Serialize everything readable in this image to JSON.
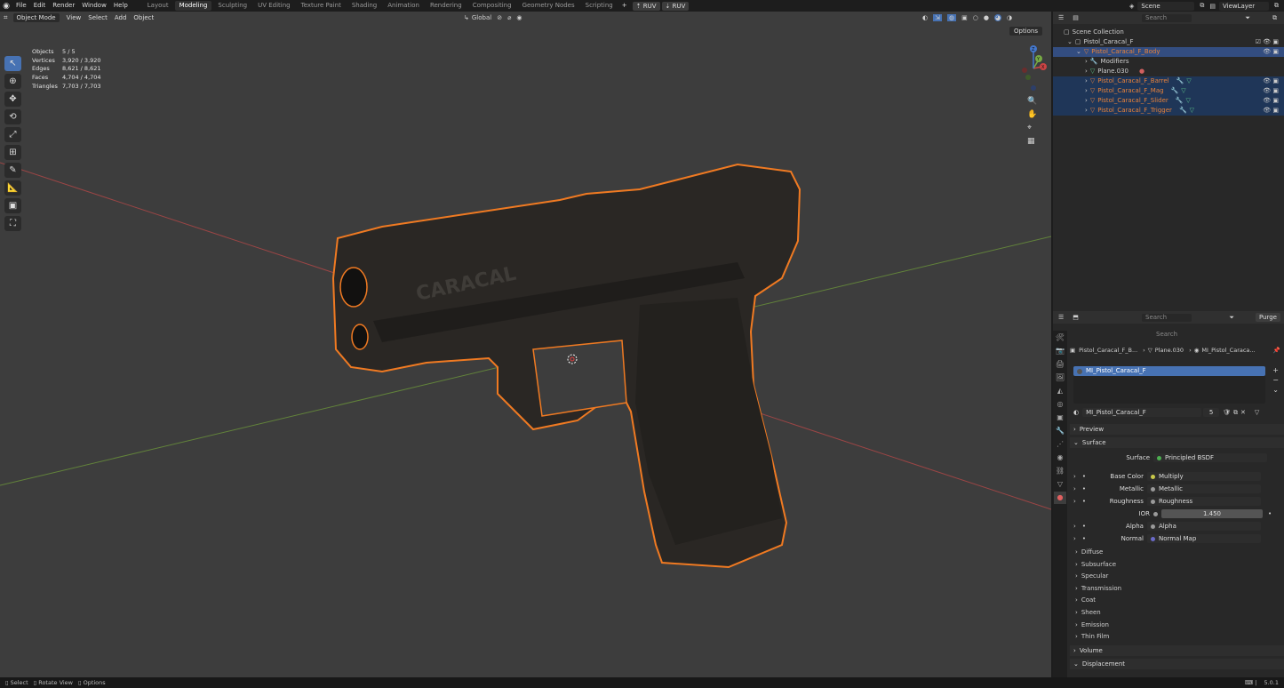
{
  "topbar": {
    "menus": [
      "File",
      "Edit",
      "Render",
      "Window",
      "Help"
    ],
    "workspaces": [
      "Layout",
      "Modeling",
      "Sculpting",
      "UV Editing",
      "Texture Paint",
      "Shading",
      "Animation",
      "Rendering",
      "Compositing",
      "Geometry Nodes",
      "Scripting"
    ],
    "active_workspace": "Modeling",
    "add_tab": "+",
    "ruv1": "RUV",
    "ruv2": "RUV",
    "scene": "Scene",
    "view_layer": "ViewLayer"
  },
  "viewport": {
    "mode": "Object Mode",
    "menus": [
      "View",
      "Select",
      "Add",
      "Object"
    ],
    "orientation": "Global",
    "options": "Options",
    "stats": [
      {
        "k": "Objects",
        "v": "5 / 5"
      },
      {
        "k": "Vertices",
        "v": "3,920 / 3,920"
      },
      {
        "k": "Edges",
        "v": "8,621 / 8,621"
      },
      {
        "k": "Faces",
        "v": "4,704 / 4,704"
      },
      {
        "k": "Triangles",
        "v": "7,703 / 7,703"
      }
    ],
    "gizmo": {
      "x": "X",
      "y": "Y",
      "z": "Z"
    }
  },
  "outliner": {
    "search_placeholder": "Search",
    "scene_collection": "Scene Collection",
    "collection": "Pistol_Caracal_F",
    "body": "Pistol_Caracal_F_Body",
    "modifiers": "Modifiers",
    "plane": "Plane.030",
    "children": [
      "Pistol_Caracal_F_Barrel",
      "Pistol_Caracal_F_Mag",
      "Pistol_Caracal_F_Slider",
      "Pistol_Caracal_F_Trigger"
    ]
  },
  "properties": {
    "search_placeholder": "Search",
    "purge": "Purge",
    "breadcrumb": {
      "obj": "Pistol_Caracal_F_B...",
      "mesh": "Plane.030",
      "mat": "MI_Pistol_Caraca..."
    },
    "slot": "MI_Pistol_Caracal_F",
    "material_name": "MI_Pistol_Caracal_F",
    "users": "5",
    "preview": "Preview",
    "surface_panel": "Surface",
    "surface_label": "Surface",
    "surface_value": "Principled BSDF",
    "inputs": [
      {
        "label": "Base Color",
        "value": "Multiply",
        "color": "#c8c84a"
      },
      {
        "label": "Metallic",
        "value": "Metallic",
        "color": "#9a9a9a"
      },
      {
        "label": "Roughness",
        "value": "Roughness",
        "color": "#9a9a9a"
      }
    ],
    "ior_label": "IOR",
    "ior_value": "1.450",
    "alpha_label": "Alpha",
    "alpha_value": "Alpha",
    "normal_label": "Normal",
    "normal_value": "Normal Map",
    "subpanels": [
      "Diffuse",
      "Subsurface",
      "Specular",
      "Transmission",
      "Coat",
      "Sheen",
      "Emission",
      "Thin Film"
    ],
    "volume": "Volume",
    "displacement": "Displacement"
  },
  "status": {
    "select": "Select",
    "rotate": "Rotate View",
    "options": "Options",
    "version": "5.0.1"
  },
  "colors": {
    "accent": "#4772b3",
    "selection_outline": "#f07a22",
    "x_axis": "#b04848",
    "y_axis": "#6e9440"
  }
}
